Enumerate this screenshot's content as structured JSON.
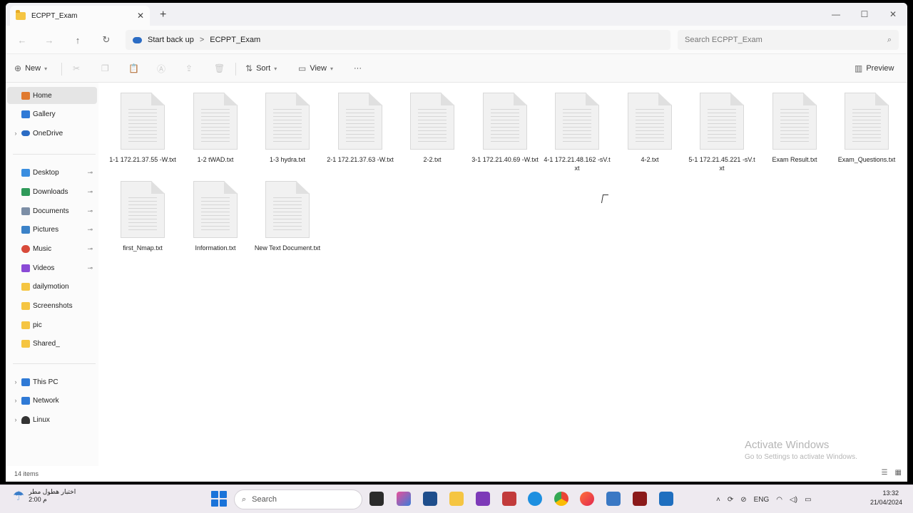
{
  "window": {
    "tab_title": "ECPPT_Exam",
    "new_tab": "+",
    "tab_close": "✕",
    "minimize": "—",
    "maximize": "☐",
    "close": "✕"
  },
  "nav": {
    "back": "←",
    "forward": "→",
    "up": "↑",
    "refresh": "↻",
    "breadcrumb": [
      "Start back up",
      "ECPPT_Exam"
    ],
    "breadcrumb_sep": ">",
    "search_placeholder": "Search ECPPT_Exam"
  },
  "toolbar": {
    "new_label": "New",
    "sort_label": "Sort",
    "view_label": "View",
    "more_label": "···",
    "preview_label": "Preview"
  },
  "sidebar": {
    "items": [
      {
        "label": "Home",
        "color": "#e07a2f"
      },
      {
        "label": "Gallery",
        "color": "#2f7ad6"
      },
      {
        "label": "OneDrive",
        "color": "#2b6cc4"
      },
      {
        "label": "Desktop",
        "color": "#3a8ee0"
      },
      {
        "label": "Downloads",
        "color": "#2f9a5a"
      },
      {
        "label": "Documents",
        "color": "#7c8ea6"
      },
      {
        "label": "Pictures",
        "color": "#3b82c8"
      },
      {
        "label": "Music",
        "color": "#d84a3a"
      },
      {
        "label": "Videos",
        "color": "#8a4ad6"
      },
      {
        "label": "dailymotion",
        "color": "#f5c542"
      },
      {
        "label": "Screenshots",
        "color": "#f5c542"
      },
      {
        "label": "pic",
        "color": "#f5c542"
      },
      {
        "label": "Shared_",
        "color": "#f5c542"
      },
      {
        "label": "This PC",
        "color": "#2f7ad6"
      },
      {
        "label": "Network",
        "color": "#2f7ad6"
      },
      {
        "label": "Linux",
        "color": "#333333"
      }
    ],
    "pin_glyph": "📌",
    "expand_glyph": "›"
  },
  "files": [
    "1-1 172.21.37.55 -W.txt",
    "1-2 tWAD.txt",
    "1-3 hydra.txt",
    "2-1 172.21.37.63 -W.txt",
    "2-2.txt",
    "3-1 172.21.40.69 -W.txt",
    "4-1 172.21.48.162 -sV.txt",
    "4-2.txt",
    "5-1 172.21.45.221 -sV.txt",
    "Exam Result.txt",
    "Exam_Questions.txt",
    "first_Nmap.txt",
    "Information.txt",
    "New Text Document.txt"
  ],
  "status": {
    "item_count": "14 items"
  },
  "watermark": {
    "line1": "Activate Windows",
    "line2": "Go to Settings to activate Windows."
  },
  "taskbar": {
    "weather_line1": "اختبار هطول مطر",
    "weather_line2": "م 2:00",
    "search_label": "Search",
    "lang": "ENG",
    "time": "13:32",
    "date": "21/04/2024"
  }
}
